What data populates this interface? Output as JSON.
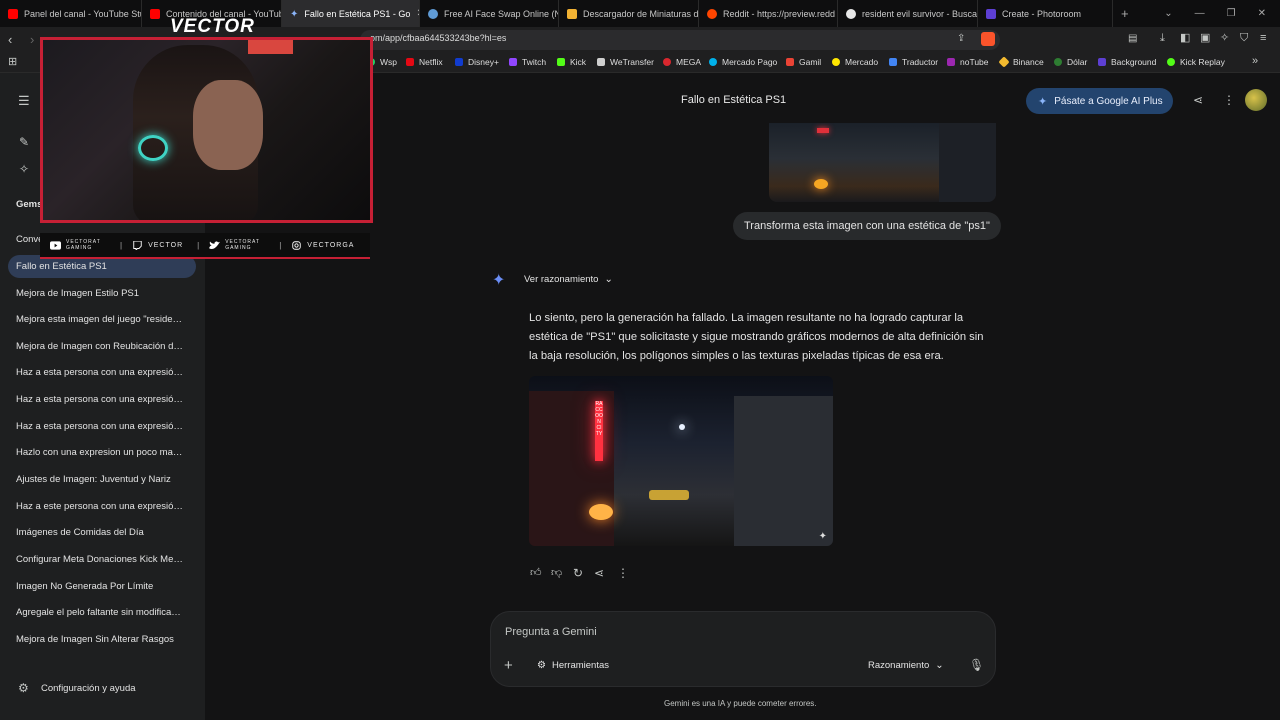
{
  "browser": {
    "tabs": [
      {
        "label": "Panel del canal - YouTube Stu",
        "color": "#ff0000"
      },
      {
        "label": "Contenido del canal - YouTub",
        "color": "#ff0000"
      },
      {
        "label": "Fallo en Estética PS1 - Go",
        "color": "#8ab4f8"
      },
      {
        "label": "Free AI Face Swap Online (No",
        "color": "#5f9bd6"
      },
      {
        "label": "Descargador de Miniaturas de",
        "color": "#f2b233"
      },
      {
        "label": "Reddit - https://preview.redd",
        "color": "#ff4500"
      },
      {
        "label": "resident evil survivor - Buscar",
        "color": "#e8e8e8"
      },
      {
        "label": "Create - Photoroom",
        "color": "#5d3fd3"
      }
    ],
    "url": "om/app/cfbaa644533243be?hl=es",
    "bookmarks": [
      {
        "label": "Wsp",
        "color": "#25d366"
      },
      {
        "label": "Netflix",
        "color": "#e50914"
      },
      {
        "label": "Disney+",
        "color": "#113ccf"
      },
      {
        "label": "Twitch",
        "color": "#9146ff"
      },
      {
        "label": "Kick",
        "color": "#53fc18"
      },
      {
        "label": "WeTransfer",
        "color": "#cfcfcf"
      },
      {
        "label": "MEGA",
        "color": "#d9272e"
      },
      {
        "label": "Mercado Pago",
        "color": "#00b1ea"
      },
      {
        "label": "Gamil",
        "color": "#ea4335"
      },
      {
        "label": "Mercado",
        "color": "#ffe600"
      },
      {
        "label": "Traductor",
        "color": "#4285f4"
      },
      {
        "label": "noTube",
        "color": "#9c27b0"
      },
      {
        "label": "Binance",
        "color": "#f3ba2f"
      },
      {
        "label": "Dólar",
        "color": "#2e7d32"
      },
      {
        "label": "Background",
        "color": "#5d3fd3"
      },
      {
        "label": "Kick Replay",
        "color": "#53fc18"
      }
    ]
  },
  "sidebar": {
    "gems_label": "Gems",
    "conversations_label": "Conve",
    "conversations": [
      "Fallo en Estética PS1",
      "Mejora de Imagen Estilo PS1",
      "Mejora esta imagen del juego \"reside…",
      "Mejora de Imagen con Reubicación d…",
      "Haz a esta persona con una expresió…",
      "Haz a esta persona con una expresió…",
      "Haz a esta persona con una expresió…",
      "Hazlo con una expresion un poco ma…",
      "Ajustes de Imagen: Juventud y Nariz",
      "Haz a este persona con una expresió…",
      "Imágenes de Comidas del Día",
      "Configurar Meta Donaciones Kick Me…",
      "Imagen No Generada Por Límite",
      "Agregale el pelo faltante sin modifica…",
      "Mejora de Imagen Sin Alterar Rasgos"
    ],
    "settings_label": "Configuración y ayuda"
  },
  "main": {
    "title": "Fallo en Estética PS1",
    "upgrade_button": "Pásate a Google AI Plus",
    "user_message": "Transforma esta imagen con una estética de \"ps1\"",
    "reasoning_toggle": "Ver razonamiento",
    "response_text": "Lo siento, pero la generación ha fallado. La imagen resultante no ha logrado capturar la estética de \"PS1\" que solicitaste y sigue mostrando gráficos modernos de alta definición sin la baja resolución, los polígonos simples o las texturas pixeladas típicas de esa era.",
    "image_sign": "RACCOON CITY",
    "input_placeholder": "Pregunta a Gemini",
    "tools_label": "Herramientas",
    "mode_label": "Razonamiento",
    "disclaimer": "Gemini es una IA y puede cometer errores."
  },
  "overlay": {
    "logo": "VECTOR",
    "socials": [
      {
        "label": "VECTORAT GAMING",
        "icon": "youtube-icon"
      },
      {
        "label": "VECTOR",
        "icon": "twitch-icon"
      },
      {
        "label": "VECTORAT GAMING",
        "icon": "twitter-icon"
      },
      {
        "label": "VECTORGA",
        "icon": "instagram-icon"
      }
    ]
  }
}
